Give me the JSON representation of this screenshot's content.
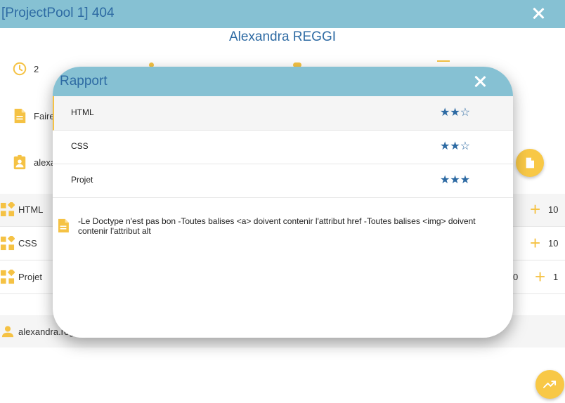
{
  "window": {
    "title": "[ProjectPool 1] 404"
  },
  "student": {
    "name": "Alexandra REGGI"
  },
  "info": {
    "time_value": "2",
    "todo_text": "Faire",
    "user_text": "alexa"
  },
  "skills": [
    {
      "name": "HTML",
      "points": "10"
    },
    {
      "name": "CSS",
      "points": "10"
    },
    {
      "name": "Projet",
      "extra": "0",
      "points": "1"
    }
  ],
  "footer": {
    "user_text": "alexandra.regg"
  },
  "report": {
    "title": "Rapport",
    "rows": [
      {
        "label": "HTML",
        "stars": "★★☆"
      },
      {
        "label": "CSS",
        "stars": "★★☆"
      },
      {
        "label": "Projet",
        "stars": "★★★"
      }
    ],
    "comment": "-Le Doctype n'est pas bon -Toutes balises <a> doivent contenir l'attribut href -Toutes balises <img> doivent contenir l'attribut alt"
  },
  "colors": {
    "header": "#86c1d3",
    "title_text": "#2d6aa3",
    "accent": "#f5c244",
    "stars": "#2d6aa3"
  },
  "icons": [
    "close-icon",
    "clock-icon",
    "document-icon",
    "badge-icon",
    "widgets-icon",
    "person-icon",
    "plus-icon",
    "trending-up-icon"
  ]
}
